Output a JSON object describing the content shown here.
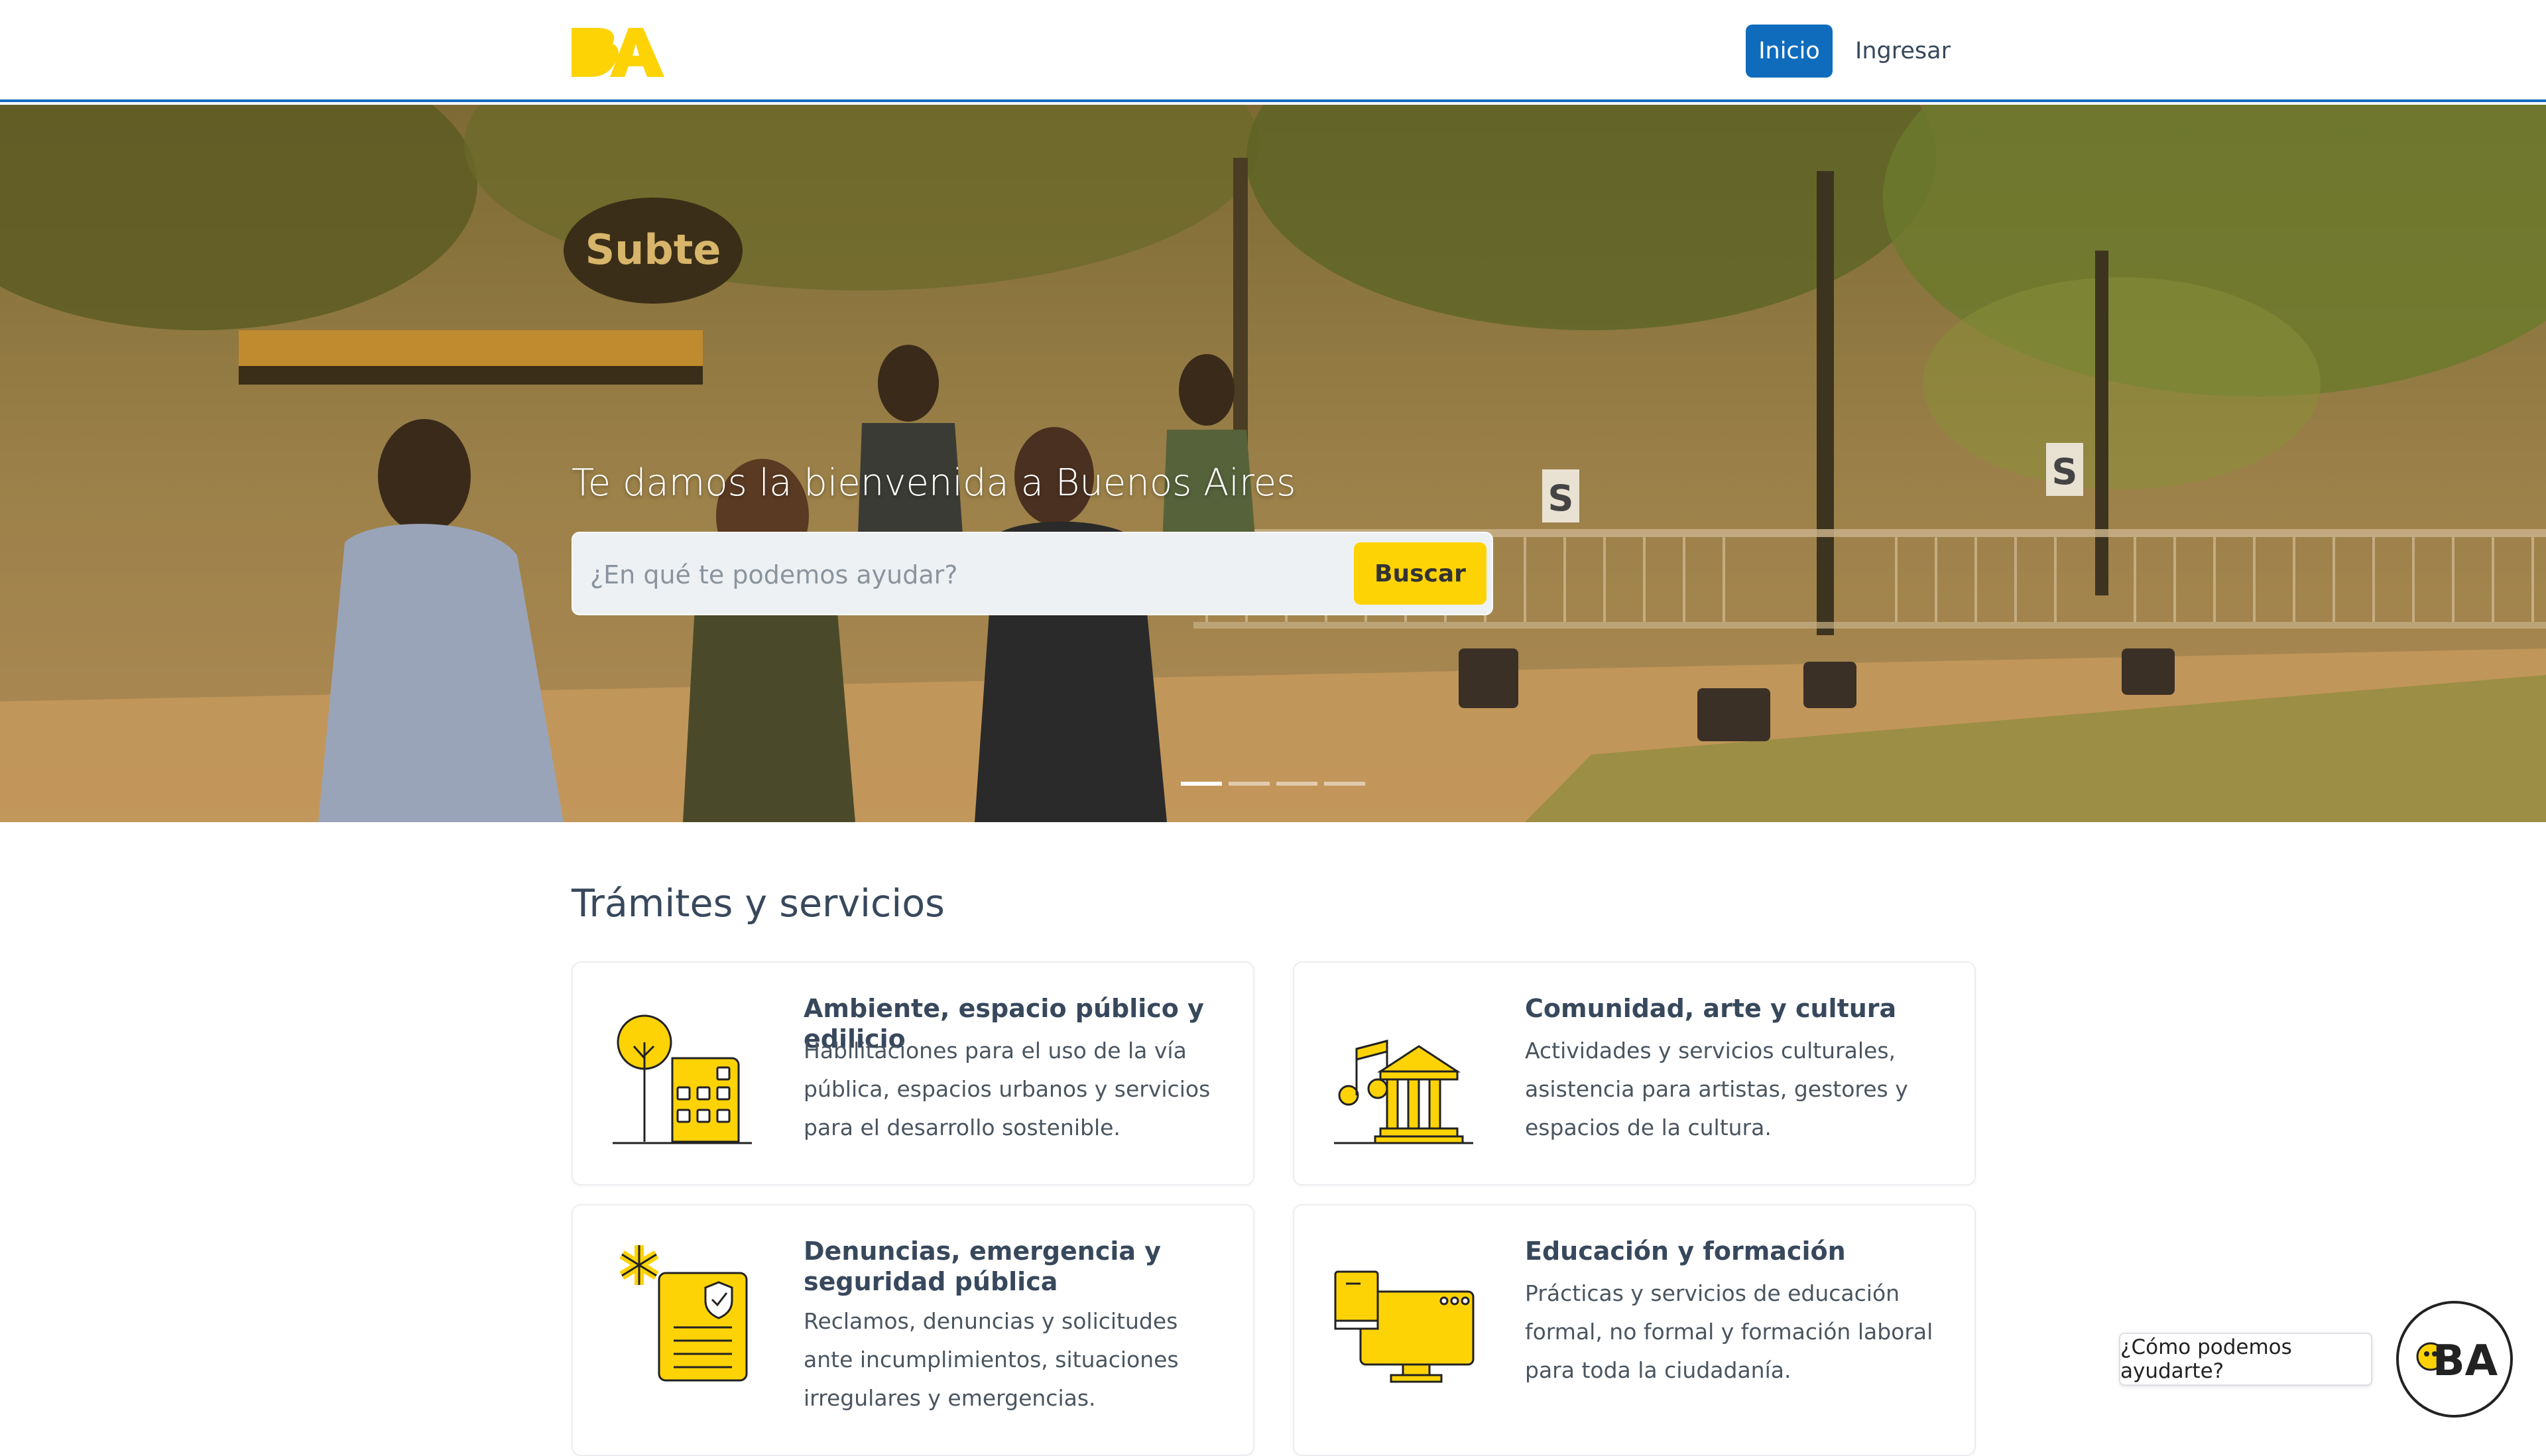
{
  "header": {
    "logo_text": "BA",
    "nav": {
      "inicio": "Inicio",
      "ingresar": "Ingresar"
    },
    "colors": {
      "primary": "#0f6cbd",
      "brand_yellow": "#fdd306"
    }
  },
  "hero": {
    "title": "Te damos la bienvenida a Buenos Aires",
    "search": {
      "placeholder": "¿En qué te podemos ayudar?",
      "value": "",
      "button": "Buscar"
    },
    "carousel": {
      "slides": 4,
      "active": 1
    },
    "scene_signs": {
      "subte": "Subte",
      "s": "S"
    }
  },
  "services": {
    "title": "Trámites y servicios",
    "cards": [
      {
        "title": "Ambiente, espacio público y edilicio",
        "desc": "Habilitaciones para el uso de la vía pública, espacios urbanos y servicios para el desarrollo sostenible.",
        "icon": "tree-building-icon"
      },
      {
        "title": "Comunidad, arte y cultura",
        "desc": "Actividades y servicios culturales, asistencia para artistas, gestores y espacios de la cultura.",
        "icon": "music-museum-icon"
      },
      {
        "title": "Denuncias, emergencia y seguridad pública",
        "desc": "Reclamos, denuncias y solicitudes ante incumplimientos, situaciones irregulares y emergencias.",
        "icon": "emergency-shield-document-icon"
      },
      {
        "title": "Educación y formación",
        "desc": "Prácticas y servicios de educación formal, no formal y formación laboral para toda la ciudadanía.",
        "icon": "book-monitor-icon"
      }
    ]
  },
  "chat": {
    "prompt": "¿Cómo podemos ayudarte?",
    "avatar_text": "BA"
  }
}
